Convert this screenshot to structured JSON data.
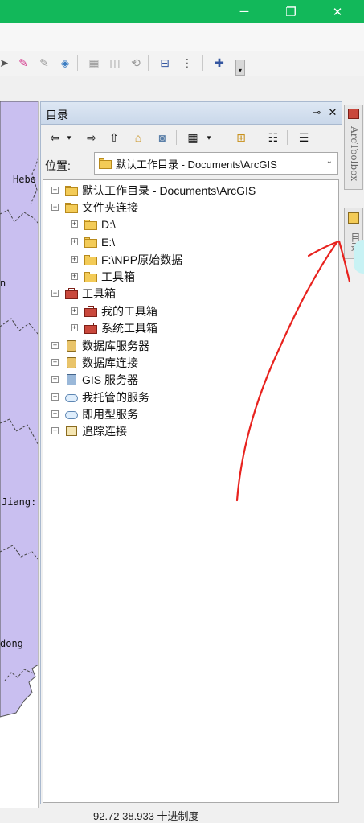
{
  "window": {
    "min_icon": "minimize-icon",
    "max_icon": "restore-icon",
    "close_icon": "close-icon"
  },
  "map": {
    "labels": [
      "Hebe",
      "n",
      "Jiang:",
      "dong"
    ]
  },
  "catalog": {
    "title": "目录",
    "pin_glyph": "ᵖ",
    "close_glyph": "✕",
    "location_label": "位置:",
    "location_value": "默认工作目录 - Documents\\ArcGIS",
    "tree": [
      {
        "label": "默认工作目录 - Documents\\ArcGIS",
        "expander": "+",
        "icon": "home-folder-icon"
      },
      {
        "label": "文件夹连接",
        "expander": "−",
        "icon": "folder-connection-icon"
      },
      {
        "label": "D:\\",
        "expander": "+",
        "icon": "folder-icon"
      },
      {
        "label": "E:\\",
        "expander": "+",
        "icon": "folder-icon"
      },
      {
        "label": "F:\\NPP原始数据",
        "expander": "+",
        "icon": "folder-icon"
      },
      {
        "label": "工具箱",
        "expander": "+",
        "icon": "folder-icon"
      },
      {
        "label": "工具箱",
        "expander": "−",
        "icon": "toolbox-icon"
      },
      {
        "label": "我的工具箱",
        "expander": "+",
        "icon": "toolbox-icon"
      },
      {
        "label": "系统工具箱",
        "expander": "+",
        "icon": "toolbox-icon"
      },
      {
        "label": "数据库服务器",
        "expander": "+",
        "icon": "database-server-icon"
      },
      {
        "label": "数据库连接",
        "expander": "+",
        "icon": "database-connection-icon"
      },
      {
        "label": "GIS 服务器",
        "expander": "+",
        "icon": "gis-server-icon"
      },
      {
        "label": "我托管的服务",
        "expander": "+",
        "icon": "hosted-services-icon"
      },
      {
        "label": "即用型服务",
        "expander": "+",
        "icon": "ready-services-icon"
      },
      {
        "label": "追踪连接",
        "expander": "+",
        "icon": "tracking-connection-icon"
      }
    ]
  },
  "side_tabs": {
    "arctoolbox": "ArcToolbox",
    "catalog": "目录"
  },
  "status": {
    "text": "92.72 38.933 十进制度"
  },
  "colors": {
    "titlebar": "#12b85a",
    "map_fill": "#c9bff0",
    "annotation": "#e8221e"
  }
}
